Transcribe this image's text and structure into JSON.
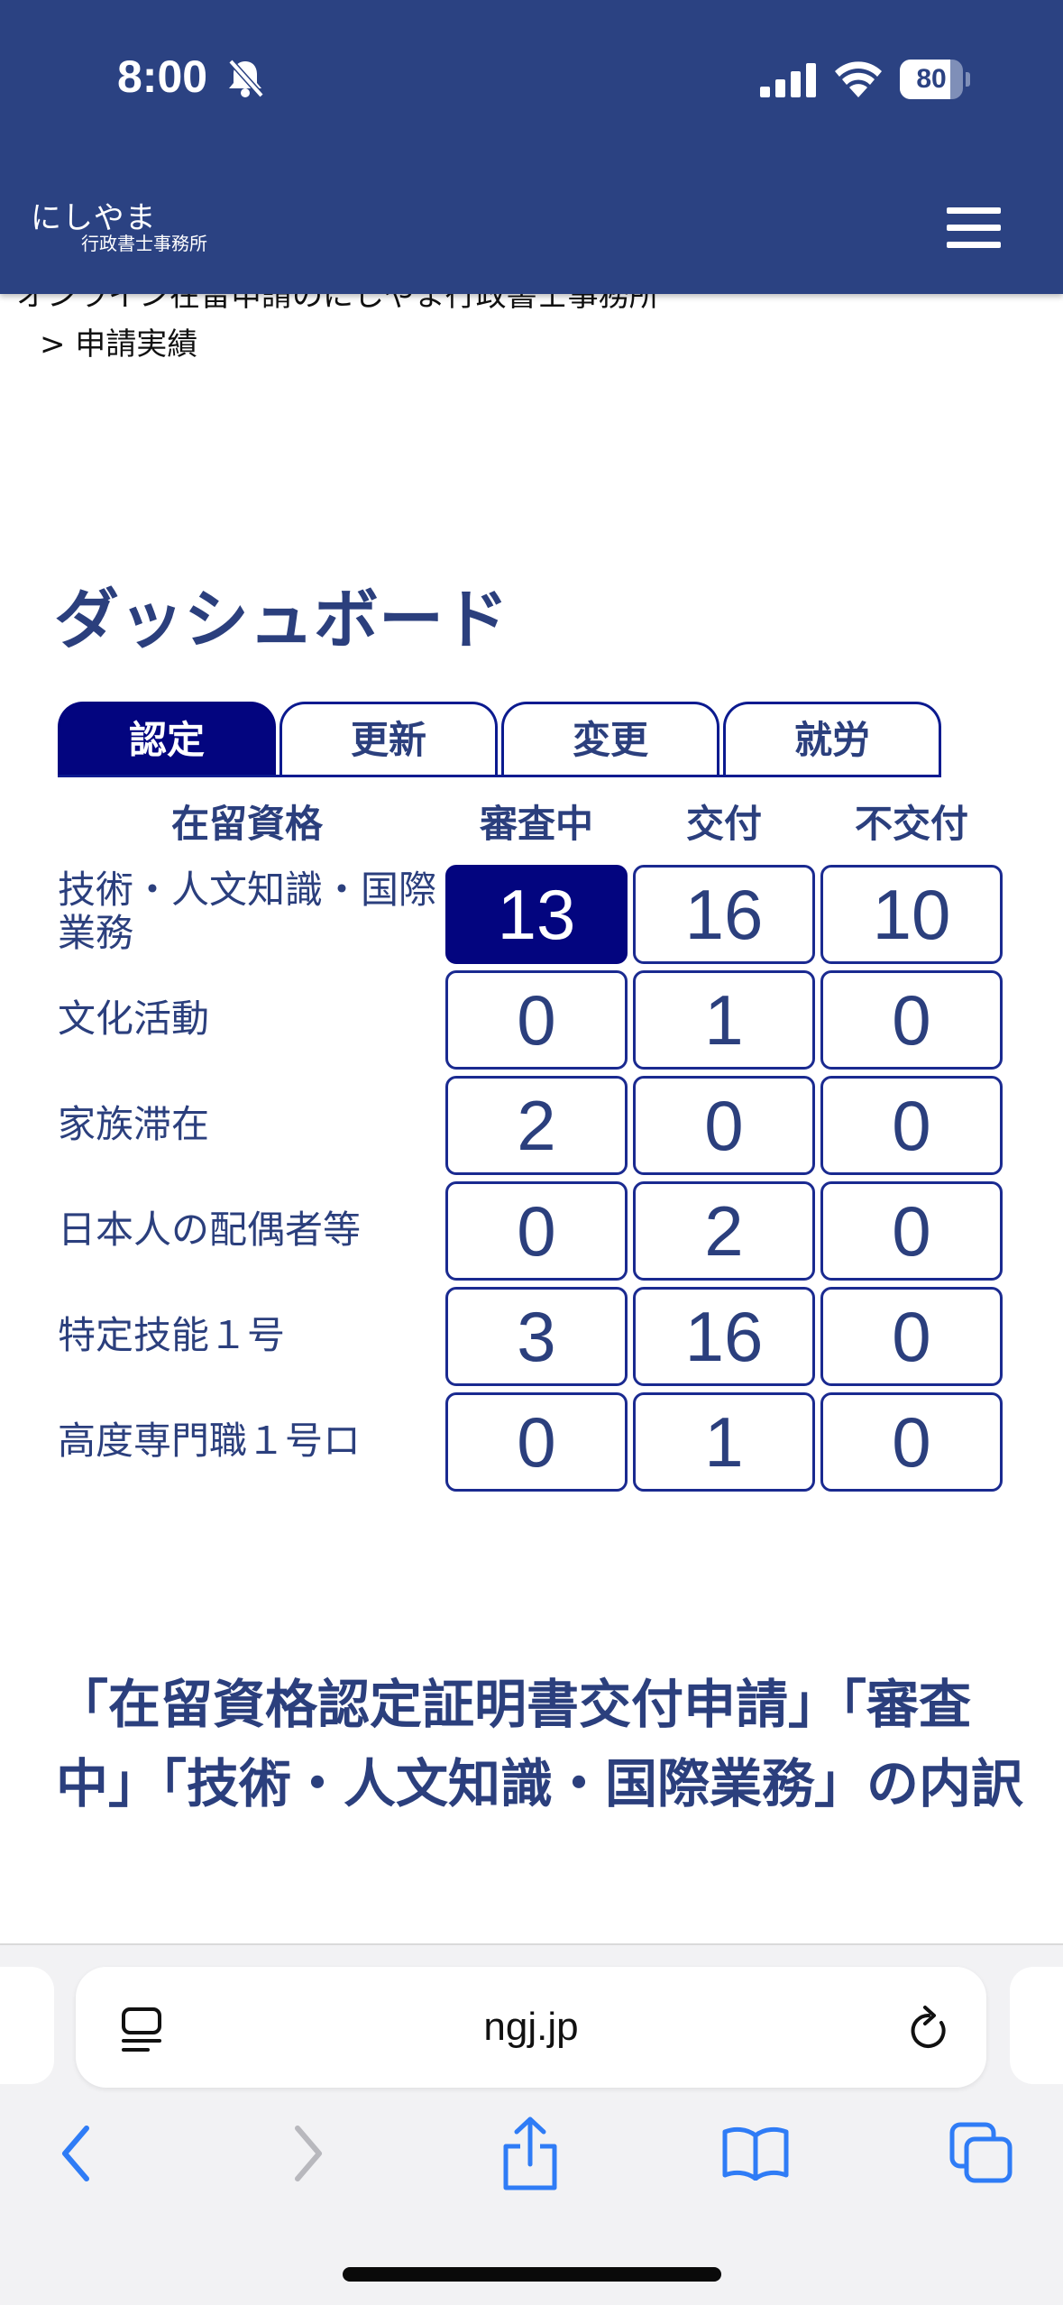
{
  "status_bar": {
    "time": "8:00",
    "battery": 80,
    "icons": [
      "bell-slash-icon",
      "signal-icon",
      "wifi-icon",
      "battery-icon"
    ]
  },
  "header": {
    "logo_main": "にしやま",
    "logo_sub": "行政書士事務所",
    "menu_icon": "hamburger-menu-icon"
  },
  "breadcrumb": {
    "parent": "オンライン在留申請のにしやま行政書士事務所",
    "current": "> 申請実績"
  },
  "dashboard": {
    "title": "ダッシュボード",
    "tabs": [
      {
        "label": "認定",
        "active": true
      },
      {
        "label": "更新",
        "active": false
      },
      {
        "label": "変更",
        "active": false
      },
      {
        "label": "就労",
        "active": false
      }
    ],
    "columns": [
      "在留資格",
      "審査中",
      "交付",
      "不交付"
    ],
    "rows": [
      {
        "label": "技術・人文知識・国際業務",
        "values": [
          "13",
          "16",
          "10"
        ]
      },
      {
        "label": "文化活動",
        "values": [
          "0",
          "1",
          "0"
        ]
      },
      {
        "label": "家族滞在",
        "values": [
          "2",
          "0",
          "0"
        ]
      },
      {
        "label": "日本人の配偶者等",
        "values": [
          "0",
          "2",
          "0"
        ]
      },
      {
        "label": "特定技能１号",
        "values": [
          "3",
          "16",
          "0"
        ]
      },
      {
        "label": "高度専門職１号ロ",
        "values": [
          "0",
          "1",
          "0"
        ]
      }
    ],
    "selected_cell": {
      "row": 0,
      "col": 0
    }
  },
  "breakdown": {
    "title": "「在留資格認定証明書交付申請」「審査中」「技術・人文知識・国際業務」の内訳"
  },
  "browser": {
    "url": "ngj.jp",
    "icons": [
      "reader-icon",
      "reload-icon",
      "back-icon",
      "forward-icon",
      "share-icon",
      "bookmarks-icon",
      "tabs-icon"
    ]
  },
  "colors": {
    "header_bg": "#2b4282",
    "accent": "#03057f",
    "text": "#2b3f7d"
  }
}
